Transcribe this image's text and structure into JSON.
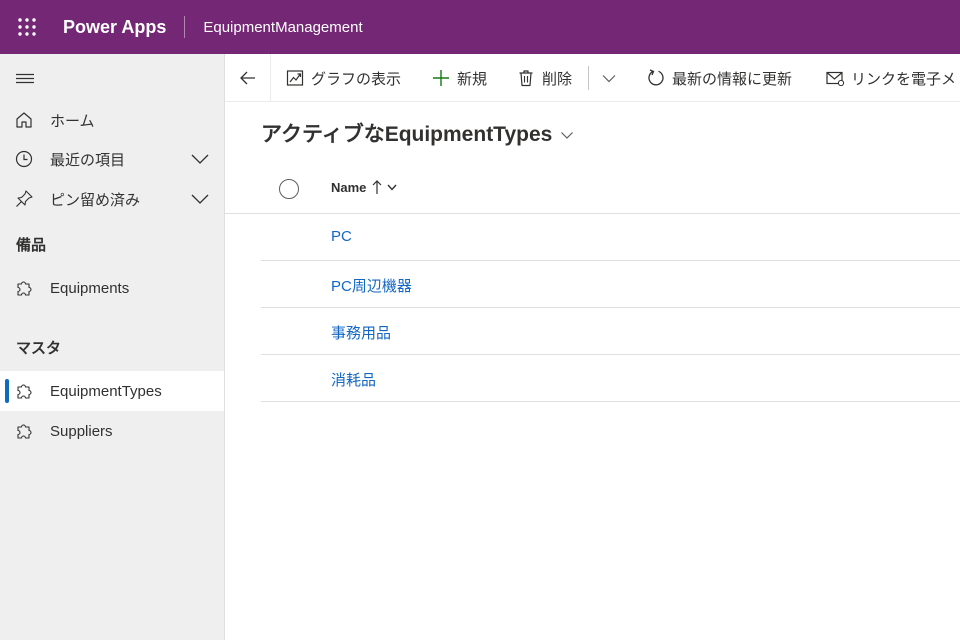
{
  "topbar": {
    "brand": "Power Apps",
    "app_name": "EquipmentManagement"
  },
  "sidebar": {
    "items_top": [
      {
        "label": "ホーム",
        "icon": "home-icon"
      },
      {
        "label": "最近の項目",
        "icon": "clock-icon"
      },
      {
        "label": "ピン留め済み",
        "icon": "pin-icon"
      }
    ],
    "groups": [
      {
        "header": "備品",
        "items": [
          {
            "label": "Equipments",
            "icon": "puzzle-icon"
          }
        ]
      },
      {
        "header": "マスタ",
        "items": [
          {
            "label": "EquipmentTypes",
            "icon": "puzzle-icon",
            "selected": true
          },
          {
            "label": "Suppliers",
            "icon": "puzzle-icon"
          }
        ]
      }
    ]
  },
  "commands": {
    "chart": "グラフの表示",
    "new": "新規",
    "delete": "削除",
    "refresh": "最新の情報に更新",
    "email_link": "リンクを電子メ"
  },
  "view": {
    "title": "アクティブなEquipmentTypes"
  },
  "grid": {
    "column_name": "Name",
    "sort": "ascending",
    "rows": [
      "PC",
      "PC周辺機器",
      "事務用品",
      "消耗品"
    ]
  },
  "colors": {
    "topbar": "#742774",
    "link": "#1266c4",
    "selected_bar": "#0f6cbd",
    "sidebar_bg": "#efefef"
  }
}
